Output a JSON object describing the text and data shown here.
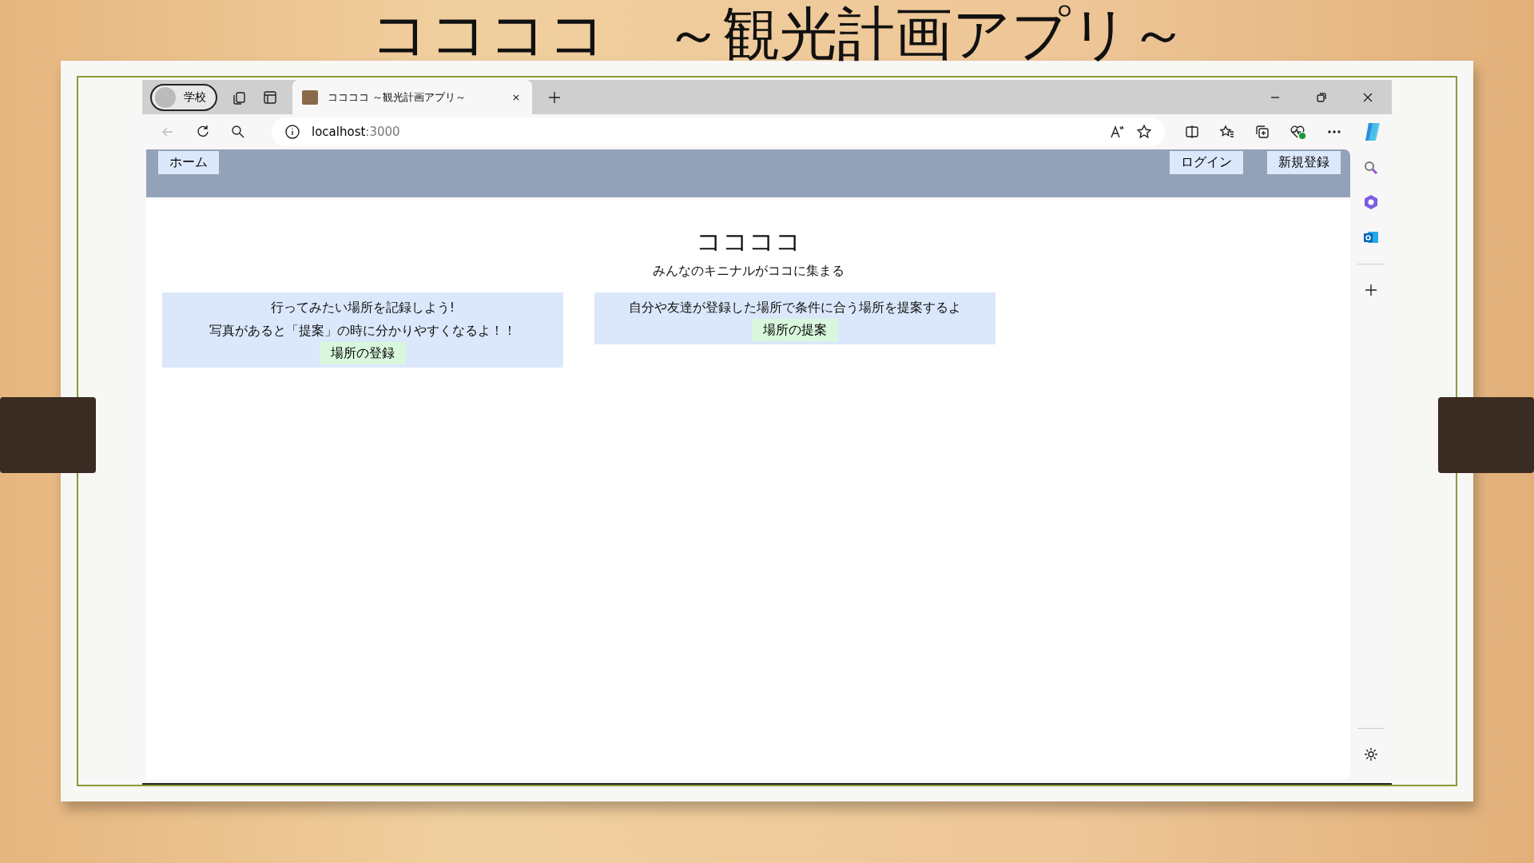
{
  "slide_title": "ココココ　～観光計画アプリ～",
  "browser": {
    "profile": "学校",
    "tabs": [
      {
        "label": "ココココ ～観光計画アプリ～",
        "selected": true
      }
    ],
    "url": {
      "host": "localhost",
      "port": ":3000"
    }
  },
  "app": {
    "nav_left": [
      "ホーム"
    ],
    "nav_right": [
      "ログイン",
      "新規登録"
    ],
    "title": "ココココ",
    "subtitle": "みんなのキニナルがココに集まる",
    "cards": [
      {
        "lines": [
          "行ってみたい場所を記録しよう!",
          "写真があると「提案」の時に分かりやすくなるよ！！"
        ],
        "button": "場所の登録"
      },
      {
        "lines": [
          "自分や友達が登録した場所で条件に合う場所を提案するよ"
        ],
        "button": "場所の提案"
      }
    ]
  }
}
